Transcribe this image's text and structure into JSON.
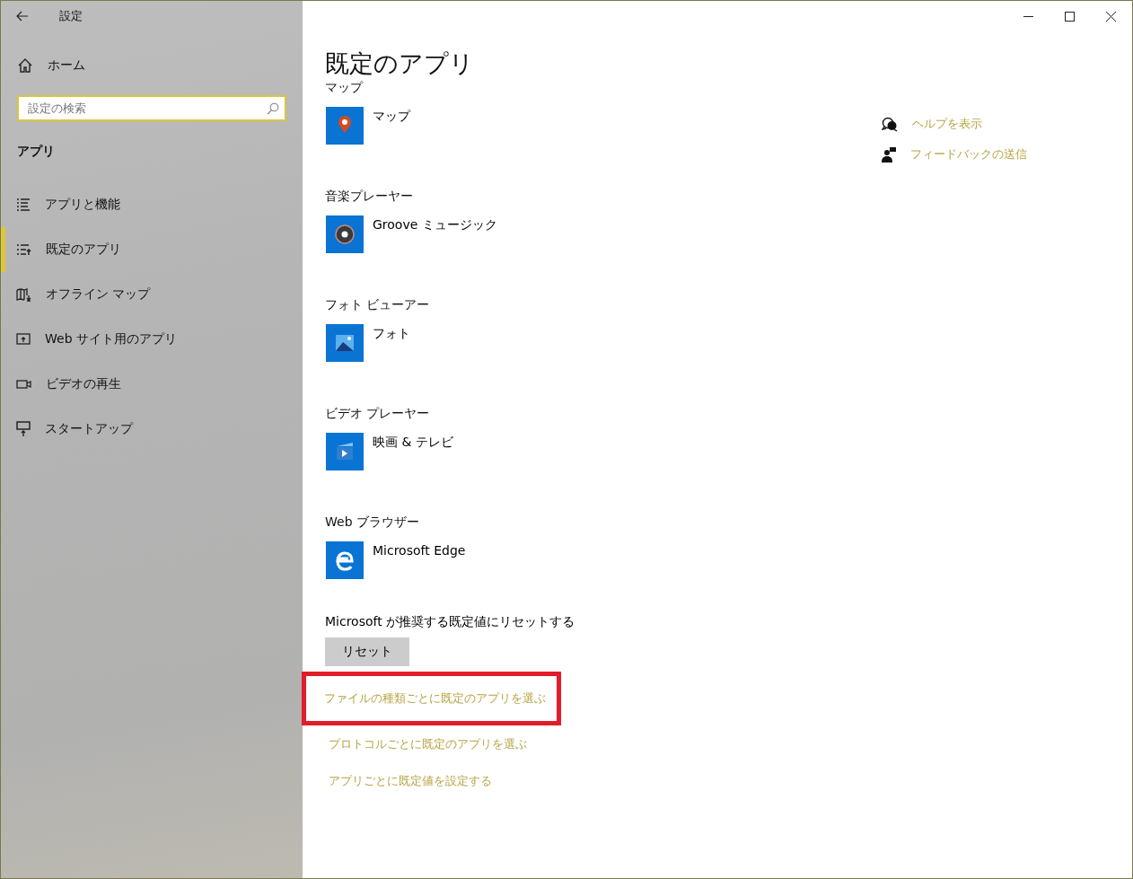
{
  "window": {
    "title": "設定"
  },
  "sidebar": {
    "home": "ホーム",
    "search": {
      "placeholder": "設定の検索"
    },
    "section": "アプリ",
    "items": [
      {
        "label": "アプリと機能",
        "kind": "list",
        "selected": false
      },
      {
        "label": "既定のアプリ",
        "kind": "defaults",
        "selected": true
      },
      {
        "label": "オフライン マップ",
        "kind": "map",
        "selected": false
      },
      {
        "label": "Web サイト用のアプリ",
        "kind": "web",
        "selected": false
      },
      {
        "label": "ビデオの再生",
        "kind": "video",
        "selected": false
      },
      {
        "label": "スタートアップ",
        "kind": "startup",
        "selected": false
      }
    ]
  },
  "main": {
    "title": "既定のアプリ",
    "defaults": [
      {
        "category": "マップ",
        "app": "マップ",
        "kind": "map"
      },
      {
        "category": "音楽プレーヤー",
        "app": "Groove ミュージック",
        "kind": "music"
      },
      {
        "category": "フォト ビューアー",
        "app": "フォト",
        "kind": "photo"
      },
      {
        "category": "ビデオ プレーヤー",
        "app": "映画 & テレビ",
        "kind": "video"
      },
      {
        "category": "Web ブラウザー",
        "app": "Microsoft Edge",
        "kind": "browser"
      }
    ],
    "reset": {
      "label": "Microsoft が推奨する既定値にリセットする",
      "button": "リセット"
    },
    "links": [
      {
        "label": "ファイルの種類ごとに既定のアプリを選ぶ",
        "highlighted": true
      },
      {
        "label": "プロトコルごとに既定のアプリを選ぶ",
        "highlighted": false
      },
      {
        "label": "アプリごとに既定値を設定する",
        "highlighted": false
      }
    ],
    "related": [
      {
        "label": "ヘルプを表示",
        "kind": "help"
      },
      {
        "label": "フィードバックの送信",
        "kind": "feedback"
      }
    ]
  }
}
